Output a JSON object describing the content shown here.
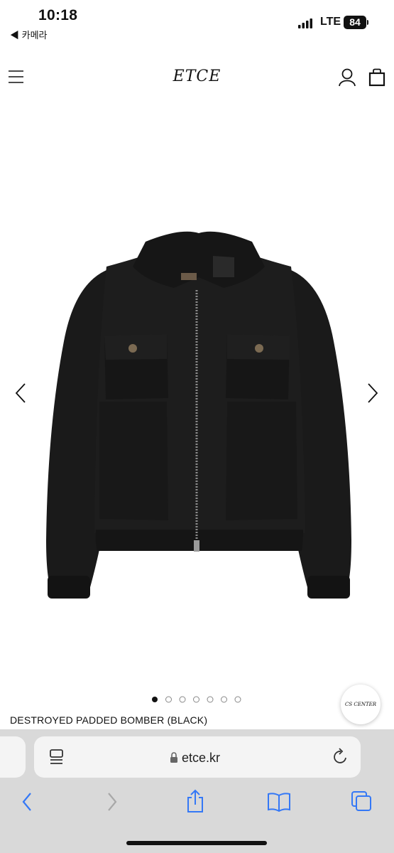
{
  "status_bar": {
    "time": "10:18",
    "back_app": "◀ 카메라",
    "network": "LTE",
    "battery": "84"
  },
  "header": {
    "logo": "ETCE",
    "menu_icon": "hamburger-menu-icon",
    "account_icon": "user-icon",
    "cart_icon": "shopping-bag-icon"
  },
  "product": {
    "title": "DESTROYED PADDED BOMBER (BLACK)",
    "image_count": 7,
    "active_image": 1
  },
  "cs_center": {
    "label": "CS CENTER"
  },
  "browser": {
    "url": "etce.kr",
    "accent_color": "#3478f6"
  }
}
